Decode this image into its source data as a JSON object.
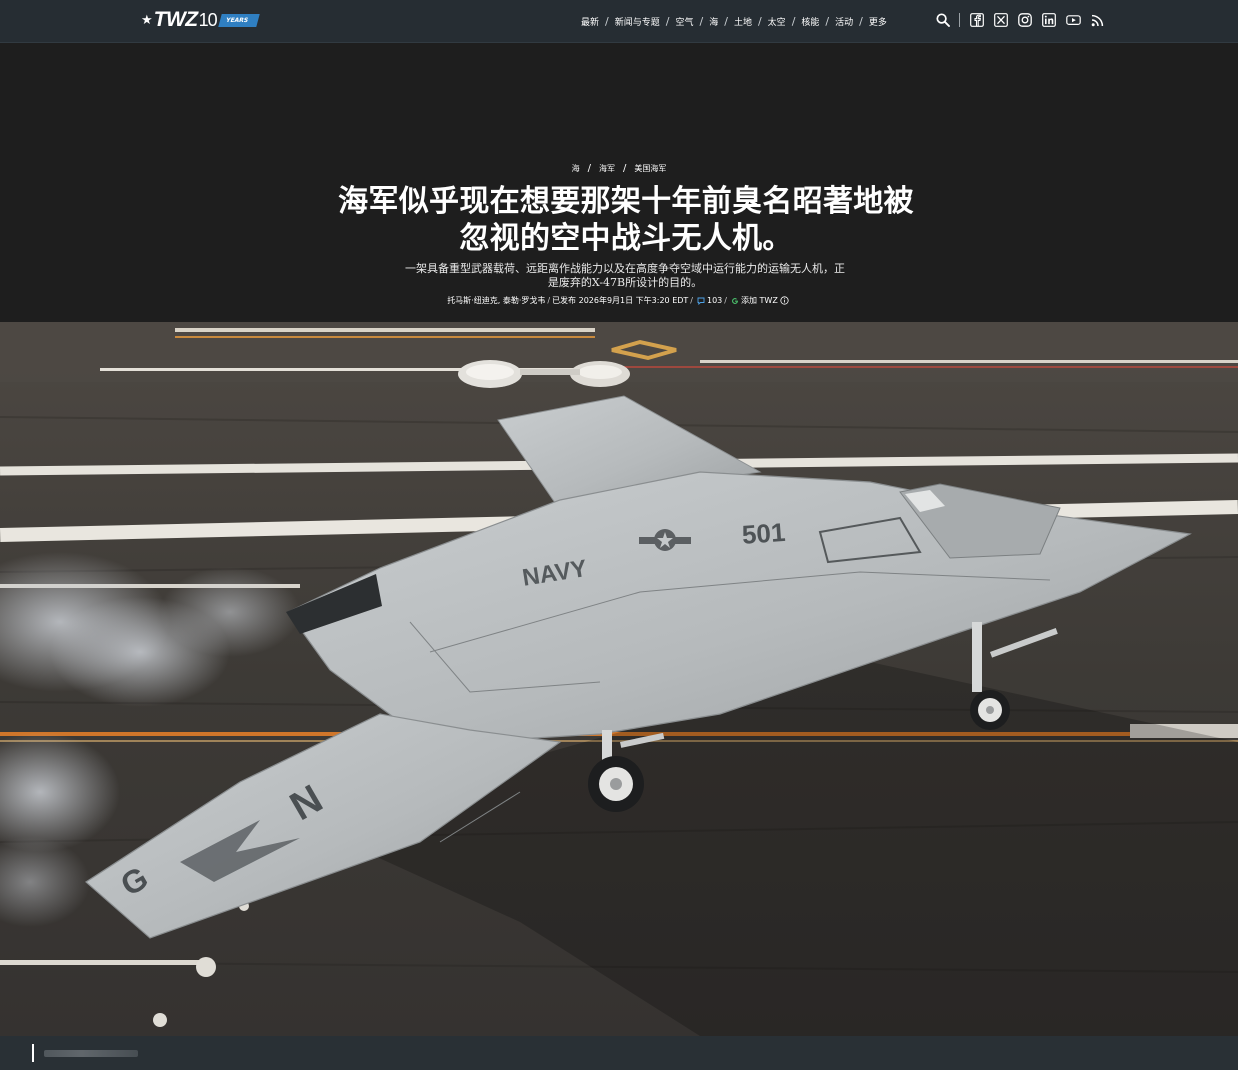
{
  "brand": {
    "logo_text": "TWZ",
    "logo_number": "10",
    "logo_badge": "YEARS"
  },
  "nav": {
    "items": [
      "最新",
      "新闻与专题",
      "空气",
      "海",
      "土地",
      "太空",
      "核能",
      "活动",
      "更多"
    ],
    "separator": "/"
  },
  "tools": {
    "icons": [
      "search-icon",
      "facebook-icon",
      "x-icon",
      "instagram-icon",
      "linkedin-icon",
      "youtube-icon",
      "rss-icon"
    ]
  },
  "article": {
    "breadcrumb": [
      "海",
      "海军",
      "美国海军"
    ],
    "headline_line1": "海军似乎现在想要那架十年前臭名昭著地被",
    "headline_line2": "忽视的空中战斗无人机。",
    "dek_line1": "一架具备重型武器载荷、远距离作战能力以及在高度争夺空域中运行能力的运输无人机，正",
    "dek_line2": "是废弃的X-47B所设计的目的。",
    "byline": {
      "authors": "托马斯·纽迪克, 泰勒·罗戈韦",
      "published": "已发布 2026年9月1日 下午3:20 EDT",
      "comments": "103",
      "follow": "添加 TWZ"
    }
  },
  "hero": {
    "aircraft_markings": {
      "service": "NAVY",
      "number": "501",
      "tail_left": "N",
      "tail_right": "G"
    },
    "colors": {
      "deck": "#3d3a36",
      "aircraft": "#b7bbbd",
      "stripe": "#e6e3dc",
      "accent_orange": "#d0762a"
    }
  },
  "colors": {
    "topbar_bg": "#262d33",
    "page_bg": "#1e1e1e",
    "logo_badge": "#2f7fc2"
  }
}
